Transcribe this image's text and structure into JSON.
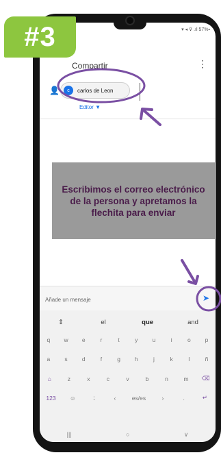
{
  "badge": {
    "label": "#3"
  },
  "status_bar": {
    "text": "▾ ◂ ⊽ .ıl 57%▪"
  },
  "header": {
    "title": "Compartir",
    "menu_icon": "more-vert-icon"
  },
  "share": {
    "recipient_icon": "person-add-icon",
    "chip_avatar": "c",
    "chip_label": "carlos de Leon",
    "role_label": "Editor ▼"
  },
  "annotation": {
    "text": "Escribimos el correo electrónico de la persona y apretamos la flechita para enviar",
    "box_color": "#9a9a9a",
    "text_color": "#4a1c4a",
    "highlight_color": "#7a4fa3"
  },
  "message": {
    "placeholder": "Añade un mensaje",
    "send_icon": "send-icon"
  },
  "keyboard": {
    "suggestions": [
      "⇕",
      "el",
      "que",
      "and"
    ],
    "row1": [
      "q",
      "w",
      "e",
      "r",
      "t",
      "y",
      "u",
      "i",
      "o",
      "p"
    ],
    "row2": [
      "a",
      "s",
      "d",
      "f",
      "g",
      "h",
      "j",
      "k",
      "l",
      "ñ"
    ],
    "row3": [
      "⌂",
      "z",
      "x",
      "c",
      "v",
      "b",
      "n",
      "m",
      "⌫"
    ],
    "row4": [
      "123",
      "☺",
      "⁏",
      "‹",
      "es/es",
      "›",
      ".",
      "↵"
    ],
    "nav": [
      "|||",
      "○",
      "∨"
    ]
  }
}
